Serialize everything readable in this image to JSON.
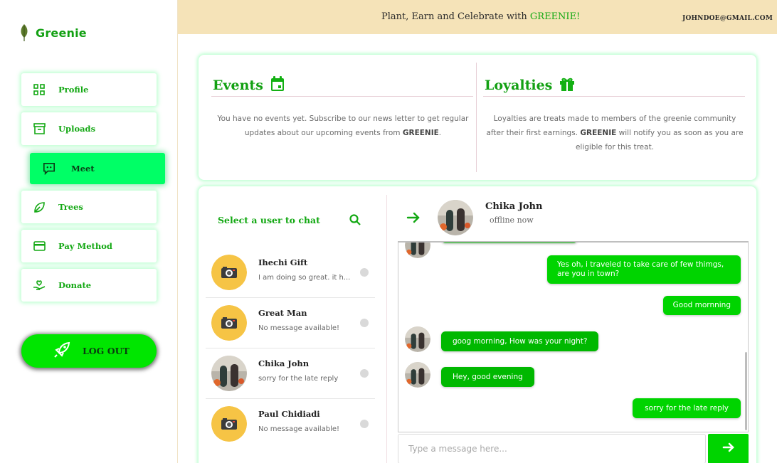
{
  "brand": {
    "name": "Greenie",
    "icon": "leaf-icon"
  },
  "header": {
    "title_prefix": "Plant, Earn and Celebrate with ",
    "title_highlight": "GREENIE!",
    "user_email": "JOHNDOE@GMAIL.COM"
  },
  "sidebar": {
    "items": [
      {
        "label": "Profile",
        "icon": "grid-icon"
      },
      {
        "label": "Uploads",
        "icon": "archive-icon"
      },
      {
        "label": "Meet",
        "icon": "chat-icon",
        "active": true
      },
      {
        "label": "Trees",
        "icon": "leaf-icon"
      },
      {
        "label": "Pay Method",
        "icon": "credit-card-icon"
      },
      {
        "label": "Donate",
        "icon": "donate-icon"
      }
    ],
    "logout_label": "LOG OUT",
    "logout_icon": "rocket-icon"
  },
  "events": {
    "title": "Events",
    "icon": "calendar-icon",
    "text_prefix": "You have no events yet. Subscribe to our news letter to get regular updates about our upcoming events from ",
    "text_brand": "GREENIE",
    "text_suffix": "."
  },
  "loyalties": {
    "title": "Loyalties",
    "icon": "gift-icon",
    "text_prefix": "Loyalties are treats made to members of the greenie community after their first earnings. ",
    "text_brand": "GREENIE",
    "text_suffix": " will notify you as soon as you are eligible for this treat."
  },
  "users_panel": {
    "heading": "Select a user to chat",
    "users": [
      {
        "name": "Ihechi Gift",
        "last_message": "I am doing so great. it h...",
        "avatar": "camera-avatar"
      },
      {
        "name": "Great Man",
        "last_message": "No message available!",
        "avatar": "camera-avatar"
      },
      {
        "name": "Chika John",
        "last_message": "sorry for the late reply",
        "avatar": "photo-avatar"
      },
      {
        "name": "Paul Chidiadi",
        "last_message": "No message available!",
        "avatar": "camera-avatar"
      }
    ]
  },
  "chat": {
    "contact_name": "Chika John",
    "contact_status": "offline now",
    "messages": [
      {
        "side": "out",
        "text": "Yes oh, i traveled to take care of few thimgs, are you in town?"
      },
      {
        "side": "out",
        "text": "Good mornning"
      },
      {
        "side": "in",
        "text": "goog morning, How was your night?"
      },
      {
        "side": "in",
        "text": "Hey, good evening"
      },
      {
        "side": "out",
        "text": "sorry for the late reply"
      }
    ],
    "input_placeholder": "Type a message here..."
  },
  "colors": {
    "brand_green": "#12a012",
    "active_nav": "#00ff66",
    "bubble_out": "#00d400",
    "bubble_in": "#00b800",
    "header_bg": "#f5e3b8"
  }
}
